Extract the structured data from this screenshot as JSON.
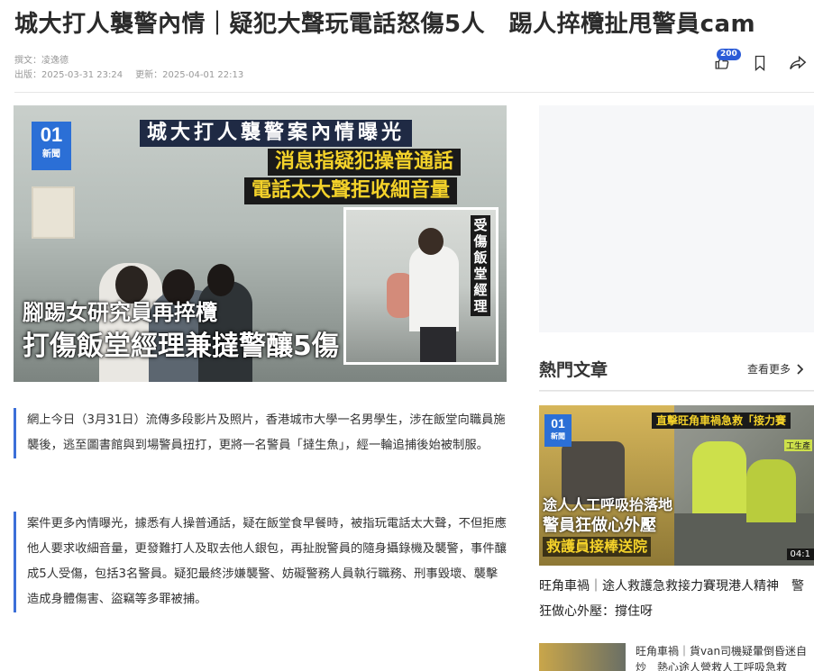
{
  "article": {
    "headline": "城大打人襲警內情｜疑犯大聲玩電話怒傷5人　踢人捽欖扯甩警員cam",
    "author_line": "撰文：凌逸德",
    "published": "出版：2025-03-31 23:24",
    "updated": "更新：2025-04-01 22:13",
    "like_count": "200",
    "paragraphs": [
      "網上今日（3月31日）流傳多段影片及照片，香港城市大學一名男學生，涉在飯堂向職員施襲後，逃至圖書館與到場警員扭打，更將一名警員「撻生魚」，經一輪追捕後始被制服。",
      "案件更多內情曝光，據悉有人操普通話，疑在飯堂食早餐時，被指玩電話太大聲，不但拒應他人要求收細音量，更發難打人及取去他人銀包，再扯脫警員的隨身攝錄機及襲警，事件釀成5人受傷，包括3名警員。疑犯最終涉嫌襲警、妨礙警務人員執行職務、刑事毀壞、襲擊造成身體傷害、盜竊等多罪被捕。"
    ]
  },
  "hero": {
    "logo_number": "01",
    "logo_text": "新聞",
    "caption_top": "城大打人襲警案內情曝光",
    "caption_yellow_1": "消息指疑犯操普通話",
    "caption_yellow_2": "電話太大聲拒收細音量",
    "inset_label": "受傷飯堂經理",
    "caption_white_1": "腳踢女研究員再捽欖",
    "caption_white_2": "打傷飯堂經理兼撻警釀5傷"
  },
  "sidebar": {
    "hot_title": "熱門文章",
    "see_more": "查看更多",
    "featured": {
      "logo_number": "01",
      "logo_text": "新聞",
      "top_caption": "直擊旺角車禍急救「接力賽",
      "side_caption": "工生產",
      "caption_1": "途人人工呼吸抬落地",
      "caption_2": "警員狂做心外壓",
      "caption_3": "救護員接棒送院",
      "duration": "04:1",
      "title": "旺角車禍｜途人救護急救接力賽現港人精神　警狂做心外壓：撐住呀"
    },
    "second": {
      "title": "旺角車禍｜貨van司機疑暈倒昏迷自炒　熱心途人營救人工呼吸急救"
    }
  },
  "icons": {
    "like": "thumbs-up-icon",
    "bookmark": "bookmark-icon",
    "share": "share-icon",
    "chevron": "chevron-right-icon"
  },
  "colors": {
    "accent": "#3c6fd8",
    "badge": "#2b5bd7",
    "caption_yellow": "#f4d22a"
  }
}
